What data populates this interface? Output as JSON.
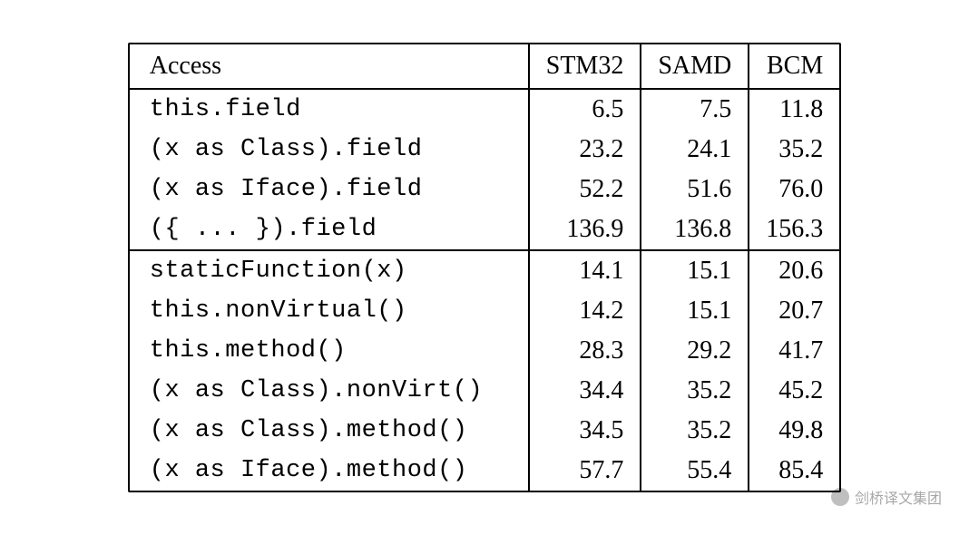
{
  "chart_data": {
    "type": "table",
    "title": "",
    "columns": [
      "Access",
      "STM32",
      "SAMD",
      "BCM"
    ],
    "sections": [
      {
        "rows": [
          {
            "access": "this.field",
            "stm32": "6.5",
            "samd": "7.5",
            "bcm": "11.8"
          },
          {
            "access": "(x as Class).field",
            "stm32": "23.2",
            "samd": "24.1",
            "bcm": "35.2"
          },
          {
            "access": "(x as Iface).field",
            "stm32": "52.2",
            "samd": "51.6",
            "bcm": "76.0"
          },
          {
            "access": "({ ... }).field",
            "stm32": "136.9",
            "samd": "136.8",
            "bcm": "156.3"
          }
        ]
      },
      {
        "rows": [
          {
            "access": "staticFunction(x)",
            "stm32": "14.1",
            "samd": "15.1",
            "bcm": "20.6"
          },
          {
            "access": "this.nonVirtual()",
            "stm32": "14.2",
            "samd": "15.1",
            "bcm": "20.7"
          },
          {
            "access": "this.method()",
            "stm32": "28.3",
            "samd": "29.2",
            "bcm": "41.7"
          },
          {
            "access": "(x as Class).nonVirt()",
            "stm32": "34.4",
            "samd": "35.2",
            "bcm": "45.2"
          },
          {
            "access": "(x as Class).method()",
            "stm32": "34.5",
            "samd": "35.2",
            "bcm": "49.8"
          },
          {
            "access": "(x as Iface).method()",
            "stm32": "57.7",
            "samd": "55.4",
            "bcm": "85.4"
          }
        ]
      }
    ]
  },
  "watermark": {
    "text": "剑桥译文集团"
  }
}
